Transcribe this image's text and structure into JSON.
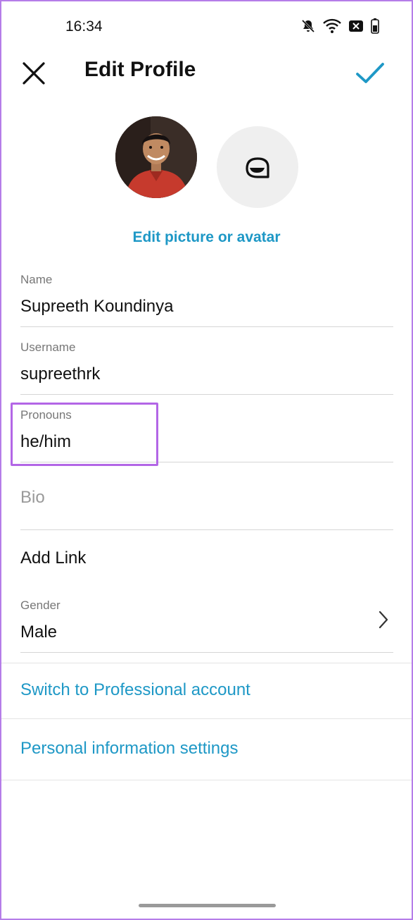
{
  "status_bar": {
    "time": "16:34",
    "icons": [
      "bell-off-icon",
      "wifi-icon",
      "battery-saver-icon",
      "battery-icon"
    ]
  },
  "header": {
    "title": "Edit Profile",
    "close_icon": "close-icon",
    "confirm_icon": "check-icon",
    "accent_color": "#1e98c6"
  },
  "avatar_section": {
    "edit_label": "Edit picture or avatar",
    "avatar_icon": "avatar-face-icon"
  },
  "fields": {
    "name": {
      "label": "Name",
      "value": "Supreeth Koundinya"
    },
    "username": {
      "label": "Username",
      "value": "supreethrk"
    },
    "pronouns": {
      "label": "Pronouns",
      "value": "he/him"
    },
    "bio": {
      "placeholder": "Bio"
    },
    "add_link": {
      "label": "Add Link"
    },
    "gender": {
      "label": "Gender",
      "value": "Male"
    }
  },
  "links": {
    "professional": "Switch to Professional account",
    "personal_info": "Personal information settings"
  },
  "highlight_color": "#b366e6"
}
